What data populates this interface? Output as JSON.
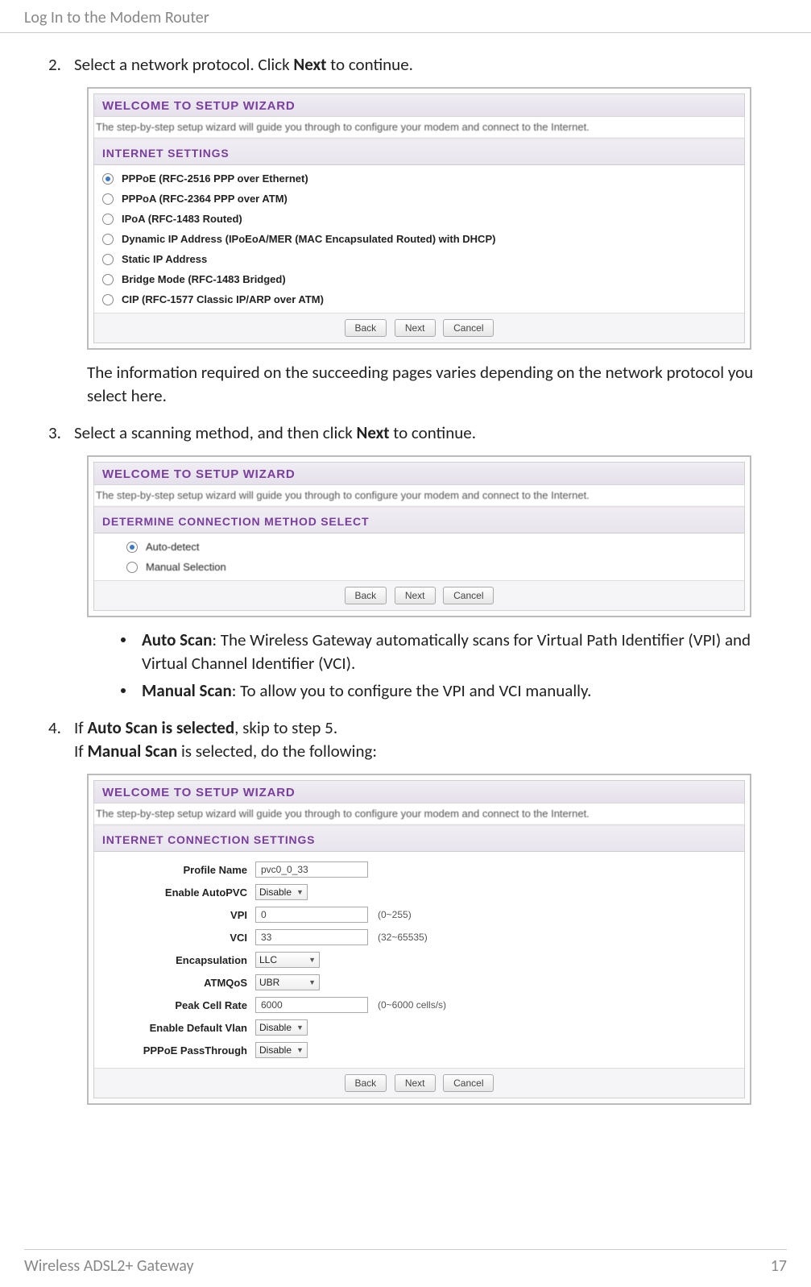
{
  "header": {
    "title": "Log In to the Modem Router"
  },
  "footer": {
    "left": "Wireless ADSL2+ Gateway",
    "page": "17"
  },
  "step2": {
    "num": "2.",
    "text_pre": "Select a network protocol. Click ",
    "text_bold": "Next",
    "text_post": " to continue.",
    "after": "The information required on the succeeding pages varies depending on the network protocol you select here."
  },
  "ss1": {
    "title": "WELCOME TO SETUP WIZARD",
    "sub": "The step-by-step setup wizard will guide you through to configure your modem and connect to the Internet.",
    "section": "INTERNET SETTINGS",
    "opts": [
      "PPPoE (RFC-2516 PPP over Ethernet)",
      "PPPoA (RFC-2364 PPP over ATM)",
      "IPoA (RFC-1483 Routed)",
      "Dynamic IP Address (IPoEoA/MER (MAC Encapsulated Routed) with DHCP)",
      "Static IP Address",
      "Bridge Mode (RFC-1483 Bridged)",
      "CIP (RFC-1577 Classic IP/ARP over ATM)"
    ],
    "btns": {
      "back": "Back",
      "next": "Next",
      "cancel": "Cancel"
    }
  },
  "step3": {
    "num": "3.",
    "text_pre": "Select a scanning method, and then click ",
    "text_bold": "Next",
    "text_post": " to continue."
  },
  "ss2": {
    "title": "WELCOME TO SETUP WIZARD",
    "sub": "The step-by-step setup wizard will guide you through to configure your modem and connect to the Internet.",
    "section": "DETERMINE CONNECTION METHOD SELECT",
    "opts": [
      "Auto-detect",
      "Manual Selection"
    ],
    "btns": {
      "back": "Back",
      "next": "Next",
      "cancel": "Cancel"
    }
  },
  "bullets": {
    "b1_bold": "Auto Scan",
    "b1_rest": ": The Wireless Gateway automatically scans for Virtual Path Identifier (VPI) and Virtual Channel Identifier (VCI).",
    "b2_bold": "Manual Scan",
    "b2_rest": ": To allow you to configure the VPI and VCI manually."
  },
  "step4": {
    "num": "4.",
    "l1_pre": "If ",
    "l1_bold": "Auto Scan is selected",
    "l1_post": ", skip to step 5.",
    "l2_pre": "If ",
    "l2_bold": "Manual Scan",
    "l2_post": " is selected, do the following:"
  },
  "ss3": {
    "title": "WELCOME TO SETUP WIZARD",
    "sub": "The step-by-step setup wizard will guide you through to configure your modem and connect to the Internet.",
    "section": "INTERNET CONNECTION SETTINGS",
    "form": {
      "profile_name": {
        "label": "Profile Name",
        "value": "pvc0_0_33"
      },
      "autopvc": {
        "label": "Enable AutoPVC",
        "value": "Disable"
      },
      "vpi": {
        "label": "VPI",
        "value": "0",
        "hint": "(0~255)"
      },
      "vci": {
        "label": "VCI",
        "value": "33",
        "hint": "(32~65535)"
      },
      "encap": {
        "label": "Encapsulation",
        "value": "LLC"
      },
      "atmqos": {
        "label": "ATMQoS",
        "value": "UBR"
      },
      "pcr": {
        "label": "Peak Cell Rate",
        "value": "6000",
        "hint": "(0~6000 cells/s)"
      },
      "vlan": {
        "label": "Enable Default Vlan",
        "value": "Disable"
      },
      "passthrough": {
        "label": "PPPoE PassThrough",
        "value": "Disable"
      }
    },
    "btns": {
      "back": "Back",
      "next": "Next",
      "cancel": "Cancel"
    }
  }
}
